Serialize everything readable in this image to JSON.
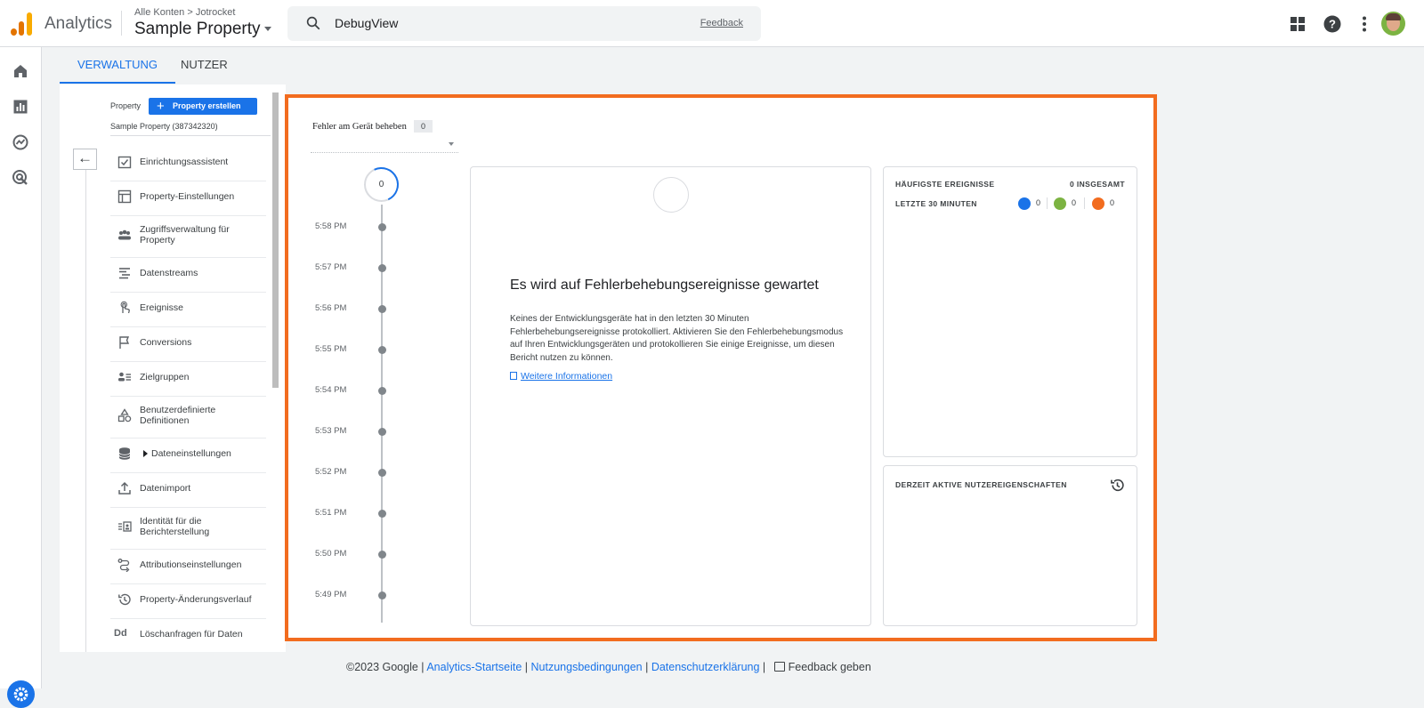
{
  "header": {
    "app_name": "Analytics",
    "breadcrumb": [
      "Alle Konten",
      "Jotrocket"
    ],
    "breadcrumb_sep": ">",
    "property": "Sample Property",
    "search_text": "DebugView",
    "feedback_link": "Feedback",
    "icons": [
      "apps-grid-icon",
      "help-icon",
      "more-vert-icon",
      "user-avatar"
    ]
  },
  "rail": {
    "icons": [
      "home-icon",
      "reports-icon",
      "explore-icon",
      "advertising-icon",
      "admin-gear-icon"
    ]
  },
  "admin": {
    "tabs": [
      {
        "label": "VERWALTUNG",
        "active": true
      },
      {
        "label": "NUTZER",
        "active": false
      }
    ],
    "property_label": "Property",
    "create_button": "Property erstellen",
    "property_name": "Sample Property (387342320)",
    "nav": [
      {
        "label": "Einrichtungsassistent",
        "icon": "checkbox-icon"
      },
      {
        "label": "Property-Einstellungen",
        "icon": "settings-window-icon"
      },
      {
        "label": "Zugriffsverwaltung für Property",
        "icon": "people-icon"
      },
      {
        "label": "Datenstreams",
        "icon": "streams-icon"
      },
      {
        "label": "Ereignisse",
        "icon": "touch-icon"
      },
      {
        "label": "Conversions",
        "icon": "flag-icon"
      },
      {
        "label": "Zielgruppen",
        "icon": "audience-icon"
      },
      {
        "label": "Benutzerdefinierte Definitionen",
        "icon": "shapes-icon"
      },
      {
        "label": "Dateneinstellungen",
        "icon": "database-icon"
      },
      {
        "label": "Datenimport",
        "icon": "upload-icon"
      },
      {
        "label": "Identität für die Berichterstellung",
        "icon": "identity-icon"
      },
      {
        "label": "Attributionseinstellungen",
        "icon": "attribution-icon"
      },
      {
        "label": "Property-Änderungsverlauf",
        "icon": "history-icon"
      },
      {
        "label": "Löschanfragen für Daten",
        "icon": "dd-icon"
      }
    ]
  },
  "debug": {
    "device_label": "Fehler am Gerät beheben",
    "device_count": "0",
    "timeline_count": "0",
    "times": [
      "5:58 PM",
      "5:57 PM",
      "5:56 PM",
      "5:55 PM",
      "5:54 PM",
      "5:53 PM",
      "5:52 PM",
      "5:51 PM",
      "5:50 PM",
      "5:49 PM"
    ],
    "waiting_title": "Es wird auf Fehlerbehebungsereignisse gewartet",
    "waiting_text": "Keines der Entwicklungsgeräte hat in den letzten 30 Minuten Fehlerbehebungsereignisse protokolliert. Aktivieren Sie den Fehlerbehebungsmodus auf Ihren Entwicklungsgeräten und protokollieren Sie einige Ereignisse, um diesen Bericht nutzen zu können.",
    "more_info_link": "Weitere Informationen",
    "top_events_title": "HÄUFIGSTE EREIGNISSE",
    "top_events_total": "0 INSGESAMT",
    "last_30": "LETZTE 30 MINUTEN",
    "event_counts": [
      {
        "icon": "event-blue-icon",
        "value": "0",
        "color": "#1a73e8"
      },
      {
        "icon": "event-green-icon",
        "value": "0",
        "color": "#7cb342"
      },
      {
        "icon": "event-orange-icon",
        "value": "0",
        "color": "#f26c1f"
      }
    ],
    "user_props_title": "DERZEIT AKTIVE NUTZEREIGENSCHAFTEN"
  },
  "footer": {
    "copyright": "©2023 Google",
    "links": [
      "Analytics-Startseite",
      "Nutzungsbedingungen",
      "Datenschutzerklärung"
    ],
    "feedback": "Feedback geben"
  },
  "colors": {
    "accent": "#1a73e8",
    "highlight_border": "#f26c1f"
  }
}
